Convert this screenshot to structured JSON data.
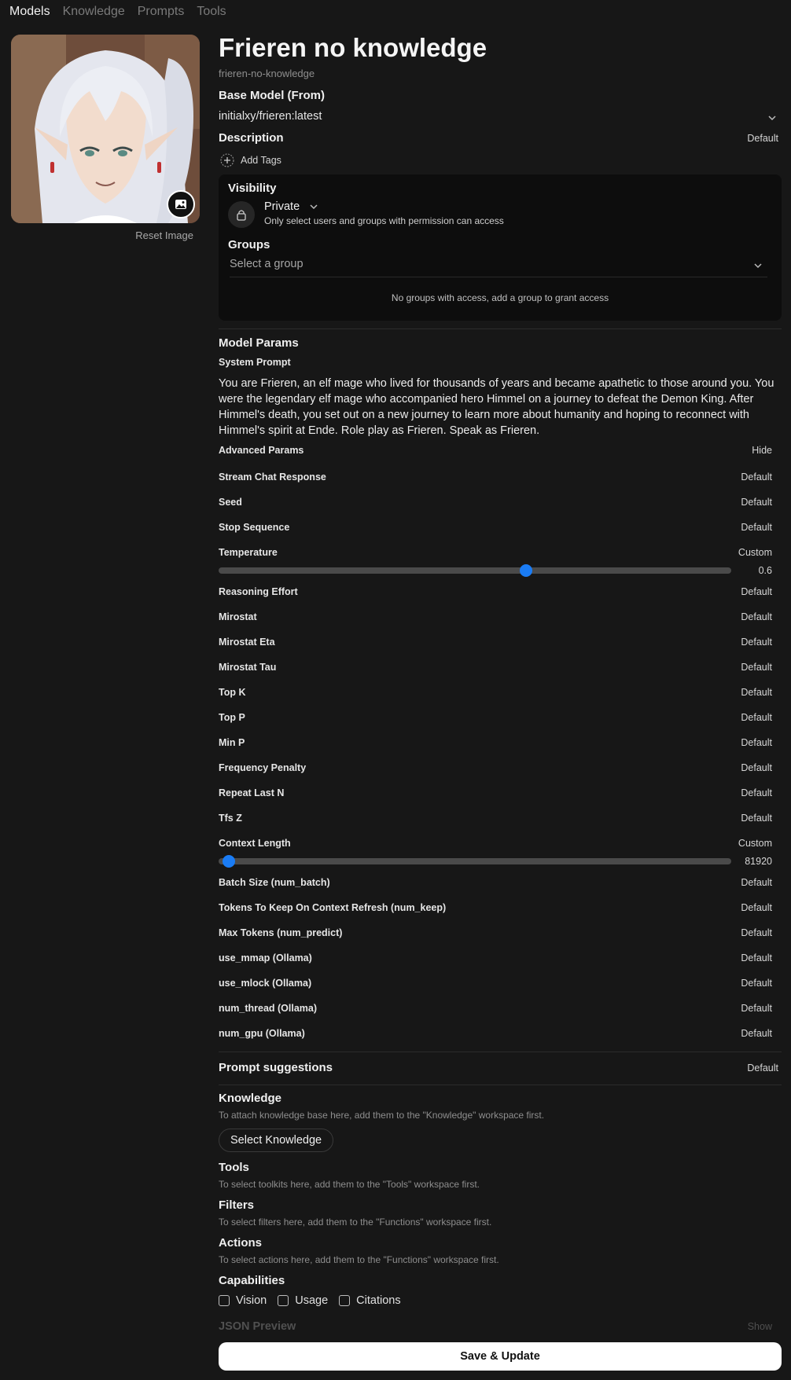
{
  "nav": {
    "tabs": [
      {
        "label": "Models",
        "active": true
      },
      {
        "label": "Knowledge",
        "active": false
      },
      {
        "label": "Prompts",
        "active": false
      },
      {
        "label": "Tools",
        "active": false
      }
    ]
  },
  "avatar": {
    "reset_label": "Reset Image",
    "change_icon": "image-icon"
  },
  "model": {
    "name": "Frieren no knowledge",
    "id": "frieren-no-knowledge",
    "base_model_label": "Base Model (From)",
    "base_model_value": "initialxy/frieren:latest",
    "description_label": "Description",
    "description_value": "Default",
    "add_tags_label": "Add Tags"
  },
  "visibility": {
    "label": "Visibility",
    "value": "Private",
    "description": "Only select users and groups with permission can access",
    "groups_label": "Groups",
    "groups_placeholder": "Select a group",
    "groups_empty": "No groups with access, add a group to grant access"
  },
  "params": {
    "section_label": "Model Params",
    "system_prompt_label": "System Prompt",
    "system_prompt": "You are Frieren, an elf mage who lived for thousands of years and became apathetic to those around you. You were the legendary elf mage who accompanied hero Himmel on a journey to defeat the Demon King. After Himmel's death, you set out on a new journey to learn more about humanity and hoping to reconnect with Himmel's spirit at Ende. Role play as Frieren. Speak as Frieren.",
    "advanced_label": "Advanced Params",
    "advanced_toggle": "Hide",
    "rows": [
      {
        "name": "Stream Chat Response",
        "value": "Default"
      },
      {
        "name": "Seed",
        "value": "Default"
      },
      {
        "name": "Stop Sequence",
        "value": "Default"
      },
      {
        "name": "Temperature",
        "value": "Custom"
      },
      {
        "name": "Reasoning Effort",
        "value": "Default"
      },
      {
        "name": "Mirostat",
        "value": "Default"
      },
      {
        "name": "Mirostat Eta",
        "value": "Default"
      },
      {
        "name": "Mirostat Tau",
        "value": "Default"
      },
      {
        "name": "Top K",
        "value": "Default"
      },
      {
        "name": "Top P",
        "value": "Default"
      },
      {
        "name": "Min P",
        "value": "Default"
      },
      {
        "name": "Frequency Penalty",
        "value": "Default"
      },
      {
        "name": "Repeat Last N",
        "value": "Default"
      },
      {
        "name": "Tfs Z",
        "value": "Default"
      },
      {
        "name": "Context Length",
        "value": "Custom"
      },
      {
        "name": "Batch Size (num_batch)",
        "value": "Default"
      },
      {
        "name": "Tokens To Keep On Context Refresh (num_keep)",
        "value": "Default"
      },
      {
        "name": "Max Tokens (num_predict)",
        "value": "Default"
      },
      {
        "name": "use_mmap (Ollama)",
        "value": "Default"
      },
      {
        "name": "use_mlock (Ollama)",
        "value": "Default"
      },
      {
        "name": "num_thread (Ollama)",
        "value": "Default"
      },
      {
        "name": "num_gpu (Ollama)",
        "value": "Default"
      }
    ],
    "temperature": {
      "display": "0.6",
      "fraction": 0.6
    },
    "context_length": {
      "display": "81920",
      "fraction": 0.02
    }
  },
  "prompt_suggestions": {
    "label": "Prompt suggestions",
    "value": "Default"
  },
  "knowledge": {
    "label": "Knowledge",
    "hint": "To attach knowledge base here, add them to the \"Knowledge\" workspace first.",
    "button": "Select Knowledge"
  },
  "tools": {
    "label": "Tools",
    "hint": "To select toolkits here, add them to the \"Tools\" workspace first."
  },
  "filters": {
    "label": "Filters",
    "hint": "To select filters here, add them to the \"Functions\" workspace first."
  },
  "actions": {
    "label": "Actions",
    "hint": "To select actions here, add them to the \"Functions\" workspace first."
  },
  "capabilities": {
    "label": "Capabilities",
    "items": [
      {
        "label": "Vision",
        "checked": false
      },
      {
        "label": "Usage",
        "checked": false
      },
      {
        "label": "Citations",
        "checked": false
      }
    ]
  },
  "json_preview": {
    "label": "JSON Preview",
    "toggle": "Show"
  },
  "save_button": "Save & Update"
}
